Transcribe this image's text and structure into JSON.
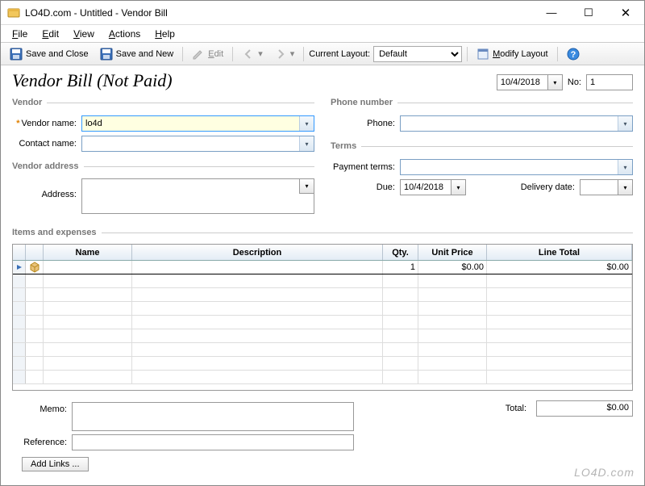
{
  "window": {
    "title": "LO4D.com - Untitled - Vendor Bill"
  },
  "menubar": {
    "file": "File",
    "edit": "Edit",
    "view": "View",
    "actions": "Actions",
    "help": "Help"
  },
  "toolbar": {
    "save_close": "Save and Close",
    "save_new": "Save and New",
    "edit": "Edit",
    "layout_label": "Current Layout:",
    "layout_value": "Default",
    "modify_layout": "Modify Layout"
  },
  "page": {
    "title": "Vendor Bill (Not Paid)",
    "date": "10/4/2018",
    "no_label": "No:",
    "no_value": "1"
  },
  "sections": {
    "vendor": "Vendor",
    "vendor_address": "Vendor address",
    "phone": "Phone number",
    "terms": "Terms",
    "items": "Items and expenses"
  },
  "labels": {
    "vendor_name": "Vendor name:",
    "contact_name": "Contact name:",
    "address": "Address:",
    "phone": "Phone:",
    "payment_terms": "Payment terms:",
    "due": "Due:",
    "delivery_date": "Delivery date:",
    "memo": "Memo:",
    "reference": "Reference:",
    "total": "Total:"
  },
  "values": {
    "vendor_name": "lo4d",
    "contact_name": "",
    "address": "",
    "phone": "",
    "payment_terms": "",
    "due": "10/4/2018",
    "delivery_date": "",
    "memo": "",
    "reference": "",
    "total": "$0.00"
  },
  "grid": {
    "headers": {
      "name": "Name",
      "description": "Description",
      "qty": "Qty.",
      "unit_price": "Unit Price",
      "line_total": "Line Total"
    },
    "rows": [
      {
        "name": "",
        "description": "",
        "qty": "1",
        "unit_price": "$0.00",
        "line_total": "$0.00"
      }
    ]
  },
  "buttons": {
    "add_links": "Add Links ..."
  },
  "watermark": "LO4D.com"
}
